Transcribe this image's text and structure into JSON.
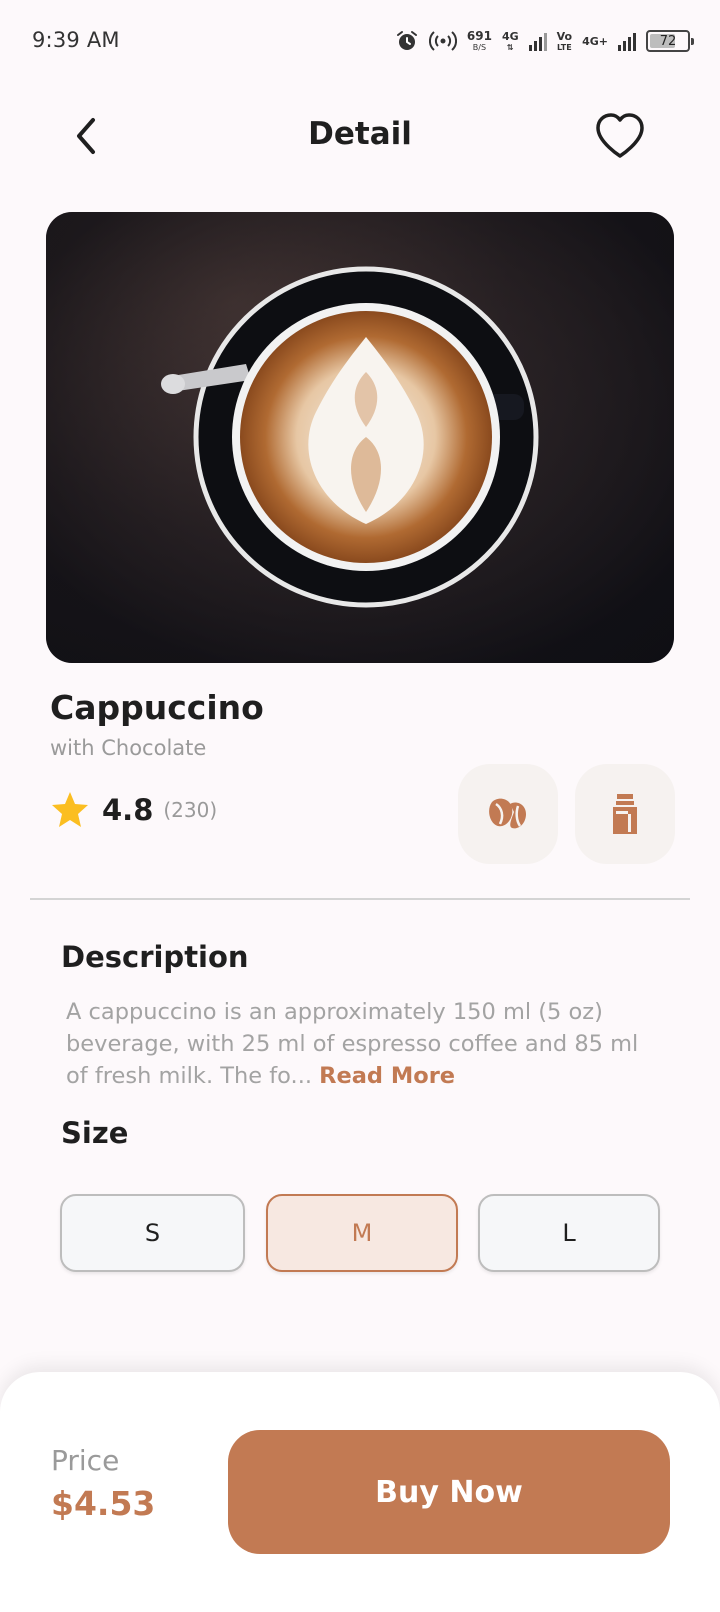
{
  "status_bar": {
    "time": "9:39 AM",
    "net_speed": "691",
    "net_speed_unit": "B/S",
    "signal_1": "4G",
    "volte_top": "Vo",
    "volte_bottom": "LTE",
    "signal_2": "4G+",
    "battery": "72",
    "battery_level": 0.72
  },
  "header": {
    "title": "Detail",
    "back_icon": "chevron-left-icon",
    "favorite_icon": "heart-icon"
  },
  "product": {
    "name": "Cappuccino",
    "subtitle": "with Chocolate",
    "rating": "4.8",
    "rating_count": "(230)",
    "badges": [
      "coffee-bean-icon",
      "milk-icon"
    ]
  },
  "description": {
    "title": "Description",
    "text": "A cappuccino is an approximately 150 ml (5 oz) beverage, with 25 ml of espresso coffee and 85 ml of fresh milk. The fo... ",
    "read_more": "Read More"
  },
  "size": {
    "title": "Size",
    "options": [
      "S",
      "M",
      "L"
    ],
    "selected": "M"
  },
  "checkout": {
    "price_label": "Price",
    "price_value": "$4.53",
    "buy_label": "Buy Now"
  },
  "colors": {
    "accent": "#c27a53",
    "accent_light": "#f7e8e1",
    "star": "#fbbe21",
    "background": "#fdf9fb"
  }
}
